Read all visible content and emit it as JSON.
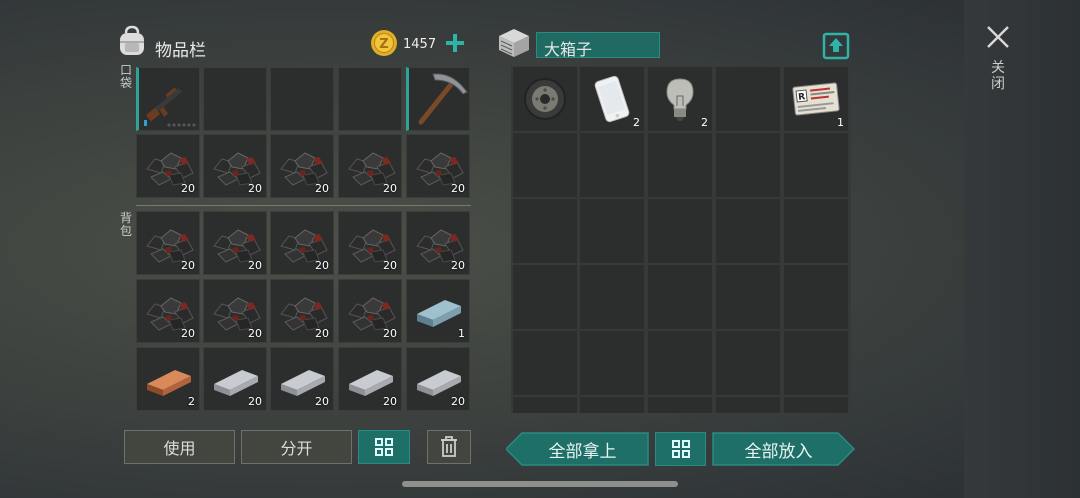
{
  "inventory": {
    "title": "物品栏",
    "coins": "1457",
    "pocket_label": "口袋",
    "backpack_label": "背包",
    "pocket": [
      {
        "icon": "ak47-rifle-icon",
        "count": ""
      },
      {
        "icon": "empty",
        "count": ""
      },
      {
        "icon": "empty",
        "count": ""
      },
      {
        "icon": "empty",
        "count": ""
      },
      {
        "icon": "pickaxe-icon",
        "count": ""
      }
    ],
    "rows": [
      [
        {
          "icon": "coal-icon",
          "count": "20"
        },
        {
          "icon": "coal-icon",
          "count": "20"
        },
        {
          "icon": "coal-icon",
          "count": "20"
        },
        {
          "icon": "coal-icon",
          "count": "20"
        },
        {
          "icon": "coal-icon",
          "count": "20"
        }
      ],
      [
        {
          "icon": "coal-icon",
          "count": "20"
        },
        {
          "icon": "coal-icon",
          "count": "20"
        },
        {
          "icon": "coal-icon",
          "count": "20"
        },
        {
          "icon": "coal-icon",
          "count": "20"
        },
        {
          "icon": "coal-icon",
          "count": "20"
        }
      ],
      [
        {
          "icon": "coal-icon",
          "count": "20"
        },
        {
          "icon": "coal-icon",
          "count": "20"
        },
        {
          "icon": "coal-icon",
          "count": "20"
        },
        {
          "icon": "coal-icon",
          "count": "20"
        },
        {
          "icon": "aluminum-ingot-icon",
          "count": "1"
        }
      ],
      [
        {
          "icon": "copper-ingot-icon",
          "count": "2"
        },
        {
          "icon": "iron-ingot-icon",
          "count": "20"
        },
        {
          "icon": "iron-ingot-icon",
          "count": "20"
        },
        {
          "icon": "iron-ingot-icon",
          "count": "20"
        },
        {
          "icon": "iron-ingot-icon",
          "count": "20"
        }
      ]
    ],
    "use_button": "使用",
    "split_button": "分开"
  },
  "container": {
    "title": "大箱子",
    "items": [
      {
        "icon": "tire-wheel-icon",
        "count": ""
      },
      {
        "icon": "smartphone-icon",
        "count": "2"
      },
      {
        "icon": "light-bulb-icon",
        "count": "2"
      },
      {
        "icon": "empty",
        "count": ""
      },
      {
        "icon": "army-id-card-icon",
        "count": "1"
      }
    ],
    "take_all_button": "全部拿上",
    "put_all_button": "全部放入"
  },
  "close_label": "关闭",
  "colors": {
    "accent": "#2fa39a",
    "button_teal": "#1e6f68",
    "slot_bg": "#2b2e2d",
    "coin": "#e3ad24"
  }
}
